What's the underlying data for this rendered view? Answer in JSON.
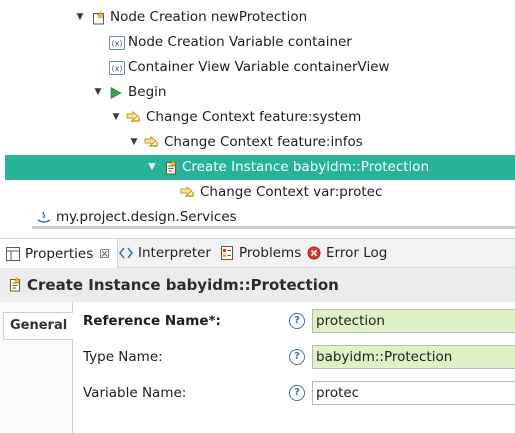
{
  "tree": {
    "items": [
      {
        "label": "Node Creation newProtection",
        "icon": "node-creation-icon",
        "expanded": true
      },
      {
        "label": "Node Creation Variable container",
        "icon": "variable-icon"
      },
      {
        "label": "Container View Variable containerView",
        "icon": "variable-icon"
      },
      {
        "label": "Begin",
        "icon": "begin-arrow-icon",
        "expanded": true
      },
      {
        "label": "Change Context feature:system",
        "icon": "change-context-icon",
        "expanded": true
      },
      {
        "label": "Change Context feature:infos",
        "icon": "change-context-icon",
        "expanded": true
      },
      {
        "label": "Create Instance babyidm::Protection",
        "icon": "create-instance-icon",
        "expanded": true,
        "selected": true
      },
      {
        "label": "Change Context var:protec",
        "icon": "change-context-icon"
      },
      {
        "label": "my.project.design.Services",
        "icon": "java-extension-icon"
      }
    ]
  },
  "views": {
    "tabs": [
      {
        "label": "Properties",
        "active": true,
        "close": "☒"
      },
      {
        "label": "Interpreter"
      },
      {
        "label": "Problems"
      },
      {
        "label": "Error Log"
      }
    ]
  },
  "properties": {
    "title": "Create Instance babyidm::Protection",
    "side_tab": "General",
    "fields": [
      {
        "label": "Reference Name*:",
        "value": "protection",
        "required": true
      },
      {
        "label": "Type Name:",
        "value": "babyidm::Protection"
      },
      {
        "label": "Variable Name:",
        "value": "protec"
      }
    ],
    "help_glyph": "?"
  },
  "colors": {
    "selection": "#26b39a",
    "field_highlight": "#dff2c5",
    "help": "#3c6fb4"
  }
}
